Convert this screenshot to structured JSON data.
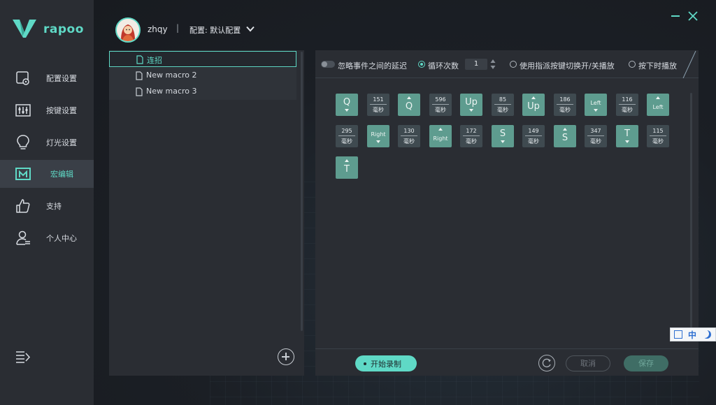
{
  "brand": {
    "name": "rapoo",
    "accent": "#5fd9c6"
  },
  "sidebar": {
    "items": [
      {
        "label": "配置设置",
        "icon": "config-settings-icon"
      },
      {
        "label": "按键设置",
        "icon": "key-settings-icon"
      },
      {
        "label": "灯光设置",
        "icon": "lightbulb-icon"
      },
      {
        "label": "宏编辑",
        "icon": "macro-edit-icon",
        "active": true
      },
      {
        "label": "支持",
        "icon": "thumbs-up-icon"
      },
      {
        "label": "个人中心",
        "icon": "user-center-icon"
      }
    ],
    "collapse_icon": "menu-collapse-icon"
  },
  "header": {
    "username": "zhqy",
    "separator": "|",
    "config_label": "配置: 默认配置"
  },
  "macros": {
    "items": [
      {
        "name": "连招",
        "active": true
      },
      {
        "name": "New macro 2"
      },
      {
        "name": "New macro 3"
      }
    ]
  },
  "toolbar": {
    "ignore_delay_label": "忽略事件之间的延迟",
    "loop_count_label": "循环次数",
    "loop_count_value": "1",
    "toggle_key_label": "使用指派按键切换开/关播放",
    "hold_play_label": "按下时播放"
  },
  "sequence": [
    {
      "kind": "key",
      "label": "Q",
      "dir": "down"
    },
    {
      "kind": "delay",
      "ms": "151",
      "unit": "毫秒"
    },
    {
      "kind": "key",
      "label": "Q",
      "dir": "up"
    },
    {
      "kind": "delay",
      "ms": "596",
      "unit": "毫秒"
    },
    {
      "kind": "key",
      "label": "Up",
      "dir": "down"
    },
    {
      "kind": "delay",
      "ms": "85",
      "unit": "毫秒"
    },
    {
      "kind": "key",
      "label": "Up",
      "dir": "up"
    },
    {
      "kind": "delay",
      "ms": "186",
      "unit": "毫秒"
    },
    {
      "kind": "key",
      "label": "Left",
      "dir": "down"
    },
    {
      "kind": "delay",
      "ms": "116",
      "unit": "毫秒"
    },
    {
      "kind": "key",
      "label": "Left",
      "dir": "up"
    },
    {
      "kind": "delay",
      "ms": "295",
      "unit": "毫秒"
    },
    {
      "kind": "key",
      "label": "Right",
      "dir": "down"
    },
    {
      "kind": "delay",
      "ms": "130",
      "unit": "毫秒"
    },
    {
      "kind": "key",
      "label": "Right",
      "dir": "up"
    },
    {
      "kind": "delay",
      "ms": "172",
      "unit": "毫秒"
    },
    {
      "kind": "key",
      "label": "S",
      "dir": "down"
    },
    {
      "kind": "delay",
      "ms": "149",
      "unit": "毫秒"
    },
    {
      "kind": "key",
      "label": "S",
      "dir": "up"
    },
    {
      "kind": "delay",
      "ms": "347",
      "unit": "毫秒"
    },
    {
      "kind": "key",
      "label": "T",
      "dir": "down"
    },
    {
      "kind": "delay",
      "ms": "115",
      "unit": "毫秒"
    },
    {
      "kind": "key",
      "label": "T",
      "dir": "up"
    }
  ],
  "footer": {
    "record_label": "开始录制",
    "cancel_label": "取消",
    "save_label": "保存"
  },
  "ime": {
    "mode_label": "中"
  }
}
